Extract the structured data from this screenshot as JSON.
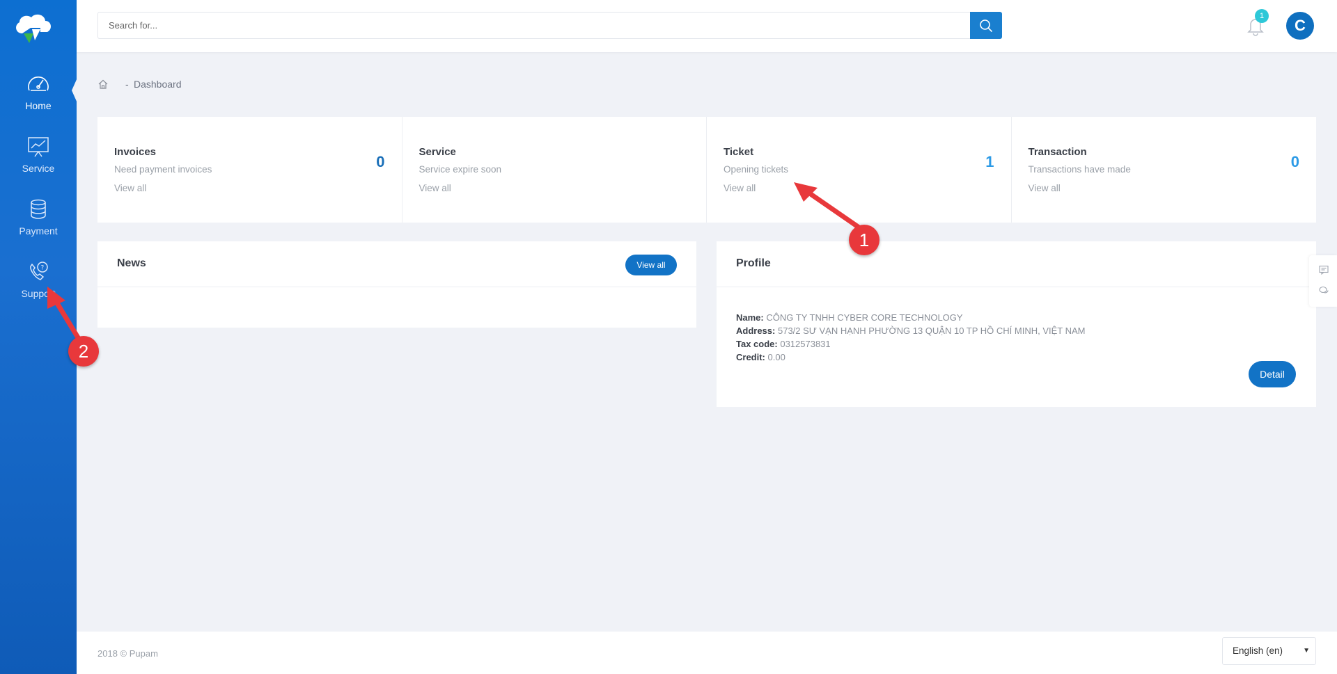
{
  "sidebar": {
    "items": [
      {
        "label": "Home",
        "icon": "speedometer-icon",
        "active": true
      },
      {
        "label": "Service",
        "icon": "chart-board-icon",
        "active": false
      },
      {
        "label": "Payment",
        "icon": "coins-icon",
        "active": false
      },
      {
        "label": "Support",
        "icon": "phone-question-icon",
        "active": false
      }
    ]
  },
  "header": {
    "search_placeholder": "Search for...",
    "notification_count": "1",
    "avatar_initial": "C"
  },
  "breadcrumb": {
    "separator": "-",
    "current": "Dashboard"
  },
  "stats": [
    {
      "title": "Invoices",
      "subtitle": "Need payment invoices",
      "link": "View all",
      "value": "0",
      "color": "#1a6fb8"
    },
    {
      "title": "Service",
      "subtitle": "Service expire soon",
      "link": "View all",
      "value": "",
      "color": "#1a6fb8"
    },
    {
      "title": "Ticket",
      "subtitle": "Opening tickets",
      "link": "View all",
      "value": "1",
      "color": "#2c9ae6"
    },
    {
      "title": "Transaction",
      "subtitle": "Transactions have made",
      "link": "View all",
      "value": "0",
      "color": "#2c9ae6"
    }
  ],
  "news": {
    "title": "News",
    "view_all": "View all"
  },
  "profile": {
    "title": "Profile",
    "name_label": "Name:",
    "name": "CÔNG TY TNHH CYBER CORE TECHNOLOGY",
    "address_label": "Address:",
    "address": "573/2 SƯ VẠN HẠNH PHƯỜNG 13 QUẬN 10 TP HỒ CHÍ MINH, VIỆT NAM",
    "tax_label": "Tax code:",
    "tax_code": "0312573831",
    "credit_label": "Credit:",
    "credit": "0.00",
    "detail_button": "Detail"
  },
  "footer": {
    "copyright": "2018 © Pupam",
    "language": "English (en)"
  },
  "annotations": [
    {
      "number": "1",
      "color": "#e8383b"
    },
    {
      "number": "2",
      "color": "#e8383b"
    }
  ],
  "colors": {
    "sidebar": "#1a6fd0",
    "accent": "#1273c6",
    "badge": "#2ec8d8",
    "annotation": "#e8383b"
  }
}
